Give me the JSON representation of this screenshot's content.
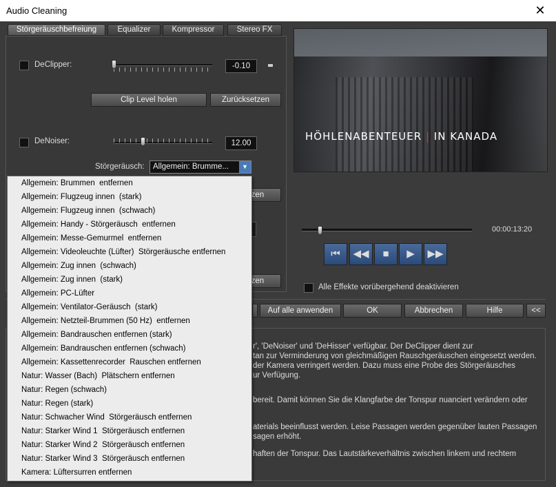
{
  "window": {
    "title": "Audio Cleaning",
    "close_glyph": "✕"
  },
  "tabs": [
    {
      "label": "Störgeräuschbefreiung",
      "active": true
    },
    {
      "label": "Equalizer"
    },
    {
      "label": "Kompressor"
    },
    {
      "label": "Stereo FX"
    }
  ],
  "declipper": {
    "label": "DeClipper:",
    "value": "-0.10",
    "btn_clip": "Clip Level holen",
    "btn_reset": "Zurücksetzen"
  },
  "denoiser": {
    "label": "DeNoiser:",
    "value": "12.00",
    "noise_label": "Störgeräusch:",
    "noise_selected": "Allgemein: Brumme..."
  },
  "hidden_btn_1": "etzen",
  "hidden_btn_2": "etzen",
  "dropdown_items": [
    "Allgemein: Brummen  entfernen",
    "Allgemein: Flugzeug innen  (stark)",
    "Allgemein: Flugzeug innen  (schwach)",
    "Allgemein: Handy - Störgeräusch  entfernen",
    "Allgemein: Messe-Gemurmel  entfernen",
    "Allgemein: Videoleuchte (Lüfter)  Störgeräusche entfernen",
    "Allgemein: Zug innen  (schwach)",
    "Allgemein: Zug innen  (stark)",
    "Allgemein: PC-Lüfter",
    "Allgemein: Ventilator-Geräusch  (stark)",
    "Allgemein: Netzteil-Brummen (50 Hz)  entfernen",
    "Allgemein: Bandrauschen entfernen (stark)",
    "Allgemein: Bandrauschen entfernen (schwach)",
    "Allgemein: Kassettenrecorder  Rauschen entfernen",
    "Natur: Wasser (Bach)  Plätschern entfernen",
    "Natur: Regen (schwach)",
    "Natur: Regen (stark)",
    "Natur: Schwacher Wind  Störgeräusch entfernen",
    "Natur: Starker Wind 1  Störgeräusch entfernen",
    "Natur: Starker Wind 2  Störgeräusch entfernen",
    "Natur: Starker Wind 3  Störgeräusch entfernen",
    "Kamera: Lüftersurren entfernen"
  ],
  "preview": {
    "title_part1": "HÖHLENABENTEUER ",
    "title_bar": "|",
    "title_part2": " IN KANADA"
  },
  "player": {
    "timecode": "00:00:13:20",
    "bypass_label": "Alle Effekte vorübergehend deaktivieren"
  },
  "buttons": {
    "apply_all": "Auf alle anwenden",
    "ok": "OK",
    "cancel": "Abbrechen",
    "help": "Hilfe",
    "collapse": "<<"
  },
  "description": [
    "r', 'DeNoiser' und 'DeHisser' verfügbar. Der DeClipper dient zur",
    "tan zur Verminderung von gleichmäßigen Rauschgeräuschen eingesetzt werden.",
    "der Kamera verringert werden. Dazu muss eine Probe des Störgeräusches",
    "ur Verfügung.",
    "bereit. Damit können Sie die Klangfarbe der Tonspur nuanciert verändern oder",
    "aterials beeinflusst werden. Leise Passagen werden gegenüber lauten Passagen",
    "sagen erhöht.",
    "haften der Tonspur. Das Lautstärkeverhältnis zwischen linkem und rechtem"
  ]
}
